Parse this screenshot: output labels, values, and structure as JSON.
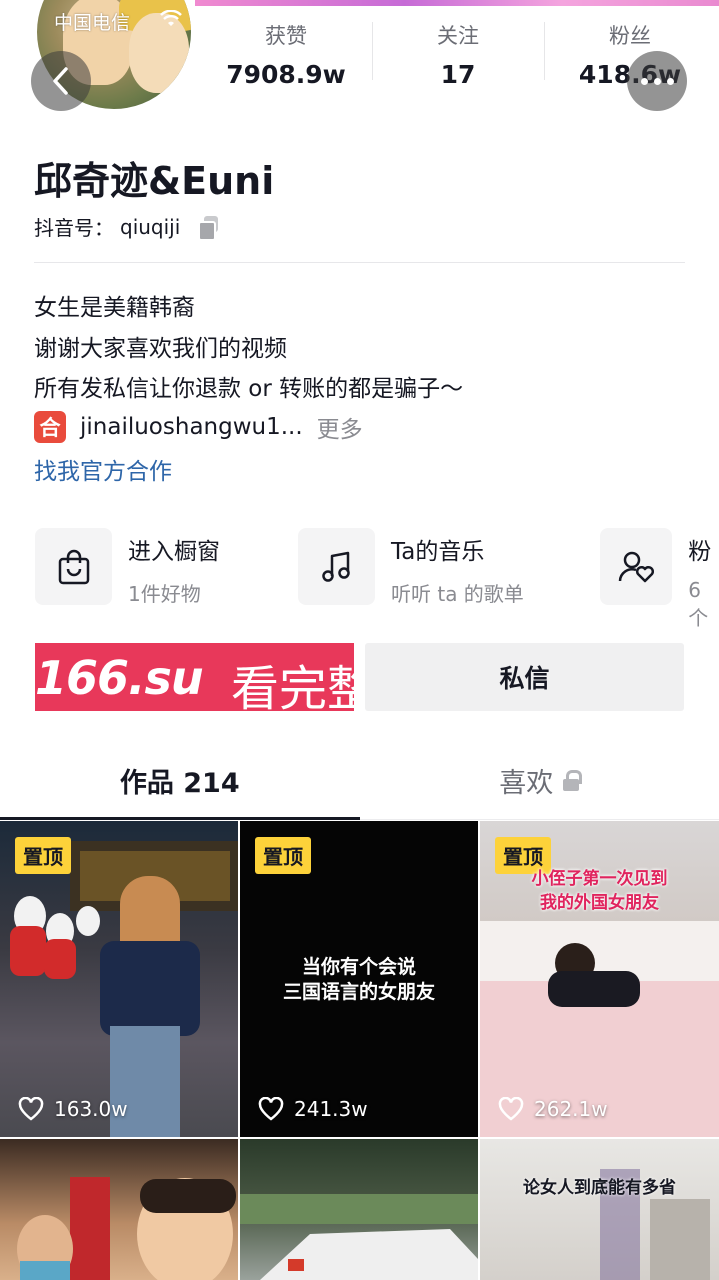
{
  "status_bar": {
    "carrier": "中国电信"
  },
  "stats": [
    {
      "label": "获赞",
      "value": "7908.9w"
    },
    {
      "label": "关注",
      "value": "17"
    },
    {
      "label": "粉丝",
      "value": "418.6w"
    }
  ],
  "profile": {
    "name": "邱奇迹&Euni",
    "douyin_id_label": "抖音号：",
    "douyin_id": "qiuqiji",
    "bio_lines": [
      "女生是美籍韩裔",
      "谢谢大家喜欢我们的视频",
      "所有发私信让你退款 or 转账的都是骗子～"
    ],
    "link_badge": "合",
    "link_text": "jinailuoshangwu1...",
    "more_label": "更多",
    "official_link": "找我官方合作"
  },
  "features": [
    {
      "title": "进入橱窗",
      "subtitle": "1件好物",
      "icon": "shopping-bag-icon"
    },
    {
      "title": "Ta的音乐",
      "subtitle": "听听 ta 的歌单",
      "icon": "music-note-icon"
    },
    {
      "title": "粉",
      "subtitle": "6个",
      "icon": "fans-icon"
    }
  ],
  "actions": {
    "ad_left": "166.su",
    "ad_right": "看完整版",
    "message_label": "私信"
  },
  "tabs": [
    {
      "label": "作品 214",
      "active": true
    },
    {
      "label": "喜欢",
      "active": false,
      "locked": true
    }
  ],
  "videos": [
    {
      "pinned": true,
      "pin_label": "置顶",
      "likes": "163.0w",
      "caption": ""
    },
    {
      "pinned": true,
      "pin_label": "置顶",
      "likes": "241.3w",
      "caption": "当你有个会说\n三国语言的女朋友"
    },
    {
      "pinned": true,
      "pin_label": "置顶",
      "likes": "262.1w",
      "caption": "小侄子第一次见到\n我的外国女朋友"
    },
    {
      "pinned": false,
      "likes": "",
      "caption": ""
    },
    {
      "pinned": false,
      "likes": "",
      "caption": ""
    },
    {
      "pinned": false,
      "likes": "",
      "caption": "论女人到底能有多省"
    }
  ],
  "colors": {
    "accent_red": "#e8385a",
    "link_blue": "#2e66a9",
    "pin_yellow": "#fdd23a"
  }
}
